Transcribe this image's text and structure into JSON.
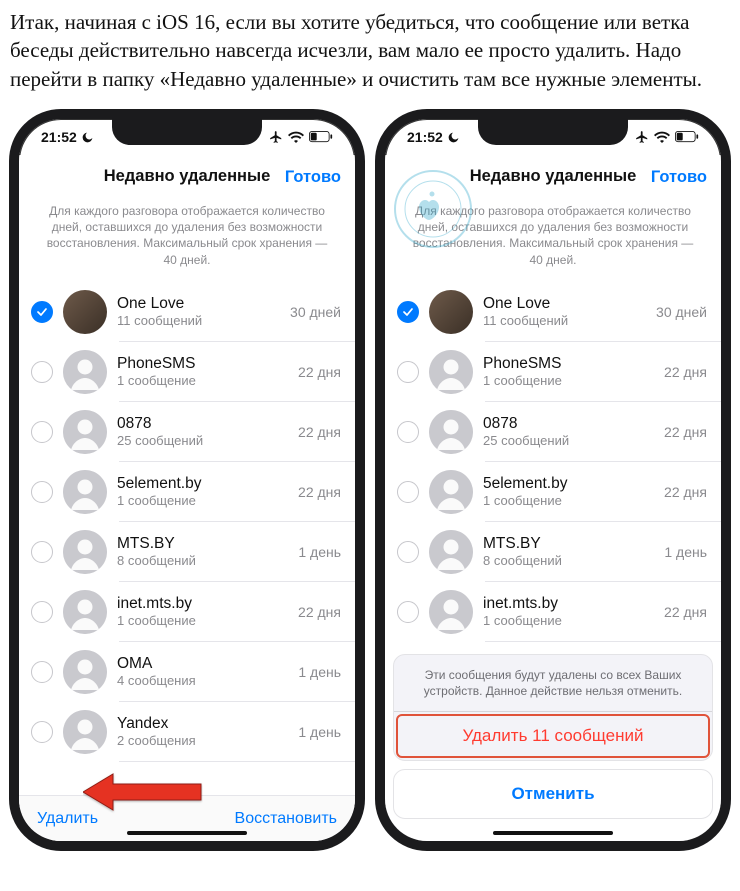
{
  "article_paragraph": "Итак, начиная с iOS 16, если вы хотите убедиться, что сообщение или ветка беседы действительно навсегда исчезли, вам мало ее просто удалить. Надо перейти в папку «Недавно удаленные» и очистить там все нужные элементы.",
  "status": {
    "time": "21:52"
  },
  "nav": {
    "title": "Недавно удаленные",
    "done": "Готово"
  },
  "subhead": "Для каждого разговора отображается количество дней, оставшихся до удаления без возможности восстановления. Максимальный срок хранения — 40 дней.",
  "conversations": [
    {
      "name": "One Love",
      "sub": "11 сообщений",
      "right": "30 дней",
      "checked": true,
      "photo": true
    },
    {
      "name": "PhoneSMS",
      "sub": "1 сообщение",
      "right": "22 дня",
      "checked": false,
      "photo": false
    },
    {
      "name": "0878",
      "sub": "25 сообщений",
      "right": "22 дня",
      "checked": false,
      "photo": false
    },
    {
      "name": "5element.by",
      "sub": "1 сообщение",
      "right": "22 дня",
      "checked": false,
      "photo": false
    },
    {
      "name": "MTS.BY",
      "sub": "8 сообщений",
      "right": "1 день",
      "checked": false,
      "photo": false
    },
    {
      "name": "inet.mts.by",
      "sub": "1 сообщение",
      "right": "22 дня",
      "checked": false,
      "photo": false
    },
    {
      "name": "OMA",
      "sub": "4 сообщения",
      "right": "1 день",
      "checked": false,
      "photo": false
    },
    {
      "name": "Yandex",
      "sub": "2 сообщения",
      "right": "1 день",
      "checked": false,
      "photo": false
    }
  ],
  "left_rows": 8,
  "right_rows": 6,
  "toolbar": {
    "delete": "Удалить",
    "restore": "Восстановить"
  },
  "sheet": {
    "message": "Эти сообщения будут удалены со всех Ваших устройств. Данное действие нельзя отменить.",
    "destructive": "Удалить 11 сообщений",
    "cancel": "Отменить"
  },
  "watermark": "MADE FOR iPHONE iPAD USER"
}
